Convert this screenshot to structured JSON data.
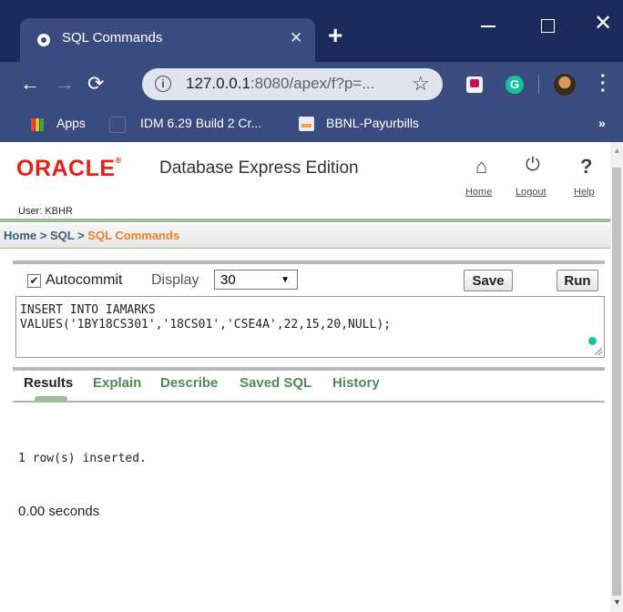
{
  "browser": {
    "tab_title": "SQL Commands",
    "tab_close": "✕",
    "new_tab": "+",
    "url_host": "127.0.0.1",
    "url_rest": ":8080/apex/f?p=...",
    "bookmarks": [
      "Apps",
      "IDM 6.29 Build 2 Cr...",
      "BBNL-Payurbills"
    ],
    "more": "»",
    "icons": [
      "back-arrow-icon",
      "forward-arrow-icon",
      "reload-icon",
      "info-icon",
      "star-icon",
      "extension-icon",
      "grammarly-icon",
      "avatar",
      "menu-icon"
    ]
  },
  "header": {
    "brand": "ORACLE",
    "product": "Database Express Edition",
    "links": {
      "home": "Home",
      "logout": "Logout",
      "help": "Help"
    },
    "user": "User: KBHR"
  },
  "breadcrumb": {
    "home": "Home",
    "sql": "SQL",
    "current": "SQL Commands"
  },
  "toolbar": {
    "autocommit_label": "Autocommit",
    "autocommit_checked": true,
    "display_label": "Display",
    "display_value": "30",
    "save_label": "Save",
    "run_label": "Run"
  },
  "editor": {
    "sql": "INSERT INTO IAMARKS\nVALUES('1BY18CS301','18CS01','CSE4A',22,15,20,NULL);"
  },
  "results_tabs": [
    "Results",
    "Explain",
    "Describe",
    "Saved SQL",
    "History"
  ],
  "output": {
    "message": "1 row(s) inserted.",
    "time": "0.00 seconds"
  },
  "colors": {
    "oracle_red": "#e2231a",
    "tab_green": "#4f8b54",
    "breadcrumb_orange": "#f07f1e",
    "chrome_blue": "#3a4c7f"
  }
}
